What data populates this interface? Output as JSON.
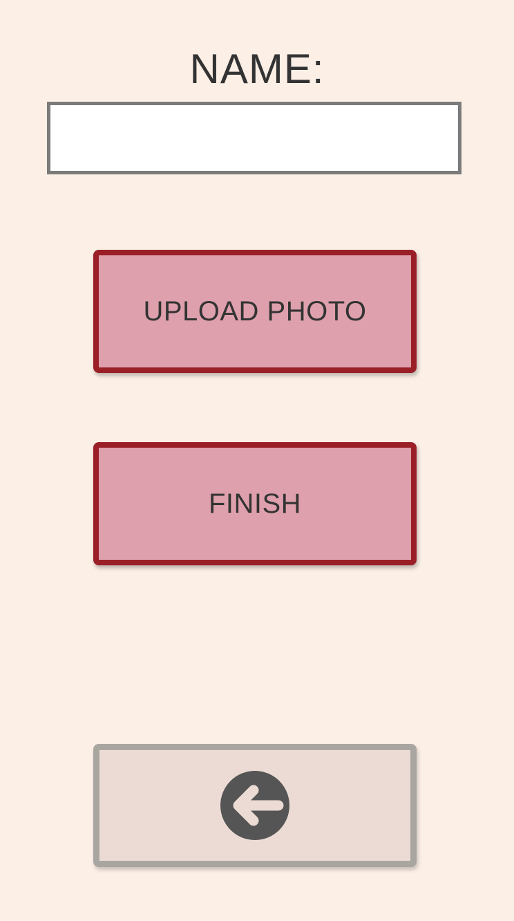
{
  "form": {
    "name_label": "NAME:",
    "name_value": "",
    "name_placeholder": ""
  },
  "buttons": {
    "upload_label": "UPLOAD PHOTO",
    "finish_label": "FINISH",
    "back_icon": "arrow-left-circle-icon"
  },
  "colors": {
    "background": "#fbefe6",
    "button_fill": "#dea0ac",
    "button_border": "#9a1f27",
    "back_fill": "#ecdbd4",
    "back_border": "#a9a6a1",
    "icon": "#555555"
  }
}
